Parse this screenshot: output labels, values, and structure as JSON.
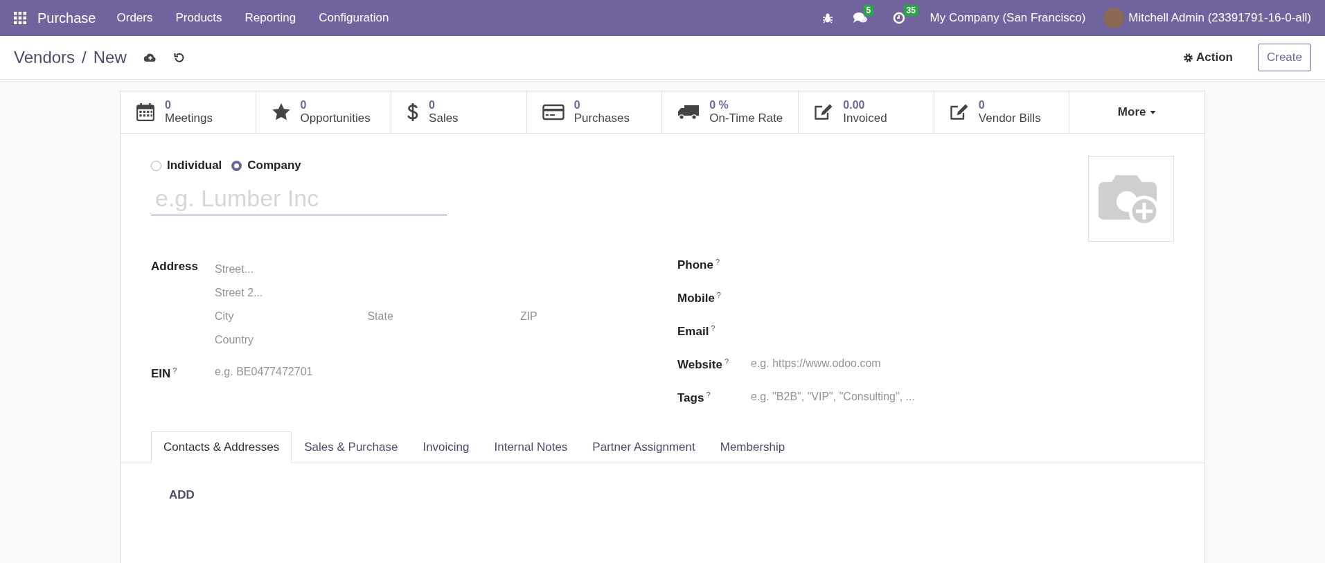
{
  "navbar": {
    "app_name": "Purchase",
    "menu": [
      "Orders",
      "Products",
      "Reporting",
      "Configuration"
    ],
    "messages_badge": "5",
    "activities_badge": "35",
    "company": "My Company (San Francisco)",
    "user": "Mitchell Admin (23391791-16-0-all)"
  },
  "breadcrumb": {
    "parent": "Vendors",
    "separator": "/",
    "current": "New"
  },
  "actions": {
    "action": "Action",
    "create": "Create"
  },
  "stat_buttons": [
    {
      "kind": "calendar",
      "value": "0",
      "label": "Meetings"
    },
    {
      "kind": "star",
      "value": "0",
      "label": "Opportunities"
    },
    {
      "kind": "dollar",
      "value": "0",
      "label": "Sales"
    },
    {
      "kind": "card",
      "value": "0",
      "label": "Purchases"
    },
    {
      "kind": "truck",
      "value": "0 %",
      "label": "On-Time Rate"
    },
    {
      "kind": "edit",
      "value": "0.00",
      "label": "Invoiced"
    },
    {
      "kind": "edit",
      "value": "0",
      "label": "Vendor Bills"
    }
  ],
  "more": "More",
  "company_type": [
    {
      "label": "Individual",
      "selected": false
    },
    {
      "label": "Company",
      "selected": true
    }
  ],
  "name_field": {
    "placeholder": "e.g. Lumber Inc"
  },
  "address": {
    "label": "Address",
    "street": {
      "placeholder": "Street..."
    },
    "street2": {
      "placeholder": "Street 2..."
    },
    "city": {
      "placeholder": "City"
    },
    "state": {
      "placeholder": "State"
    },
    "zip": {
      "placeholder": "ZIP"
    },
    "country": {
      "placeholder": "Country"
    }
  },
  "ein": {
    "label": "EIN",
    "help": "?",
    "placeholder": "e.g. BE0477472701"
  },
  "right_fields": [
    {
      "label": "Phone",
      "help": "?"
    },
    {
      "label": "Mobile",
      "help": "?"
    },
    {
      "label": "Email",
      "help": "?"
    },
    {
      "label": "Website",
      "help": "?",
      "placeholder": "e.g. https://www.odoo.com"
    },
    {
      "label": "Tags",
      "help": "?",
      "placeholder": "e.g. \"B2B\", \"VIP\", \"Consulting\", ..."
    }
  ],
  "tabs": [
    {
      "label": "Contacts & Addresses",
      "selected": true
    },
    {
      "label": "Sales & Purchase",
      "selected": false
    },
    {
      "label": "Invoicing",
      "selected": false
    },
    {
      "label": "Internal Notes",
      "selected": false
    },
    {
      "label": "Partner Assignment",
      "selected": false
    },
    {
      "label": "Membership",
      "selected": false
    }
  ],
  "add_button": "ADD"
}
